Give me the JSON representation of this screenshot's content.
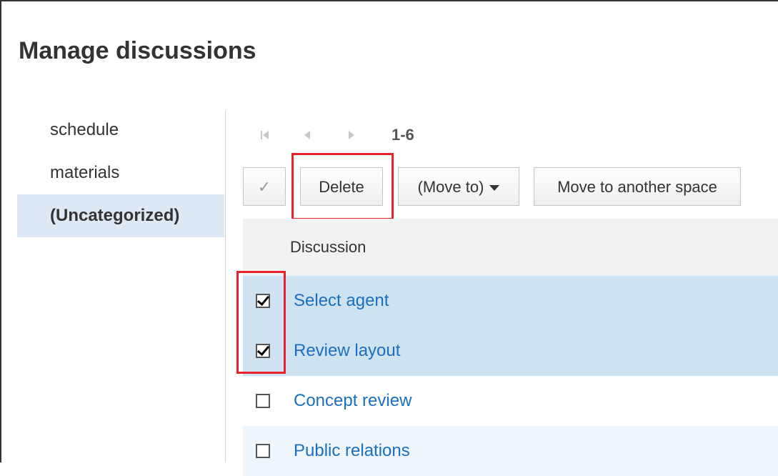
{
  "page": {
    "title": "Manage discussions"
  },
  "sidebar": {
    "items": [
      {
        "label": "schedule",
        "active": false
      },
      {
        "label": "materials",
        "active": false
      },
      {
        "label": "(Uncategorized)",
        "active": true
      }
    ]
  },
  "pager": {
    "first_icon": "first-page-icon",
    "prev_icon": "prev-page-icon",
    "next_icon": "next-page-icon",
    "range": "1-6"
  },
  "toolbar": {
    "check_icon": "checkmark-icon",
    "check_glyph": "✓",
    "delete_label": "Delete",
    "move_to_label": "(Move to)",
    "move_space_label": "Move to another space"
  },
  "table": {
    "header": "Discussion",
    "rows": [
      {
        "title": "Select agent",
        "checked": true
      },
      {
        "title": "Review layout",
        "checked": true
      },
      {
        "title": "Concept review",
        "checked": false
      },
      {
        "title": "Public relations",
        "checked": false
      }
    ]
  },
  "colors": {
    "highlight": "#e8222a",
    "link": "#1a6fbf",
    "selected_row": "#cfe2f2",
    "sidebar_active": "#dfe9f5"
  }
}
